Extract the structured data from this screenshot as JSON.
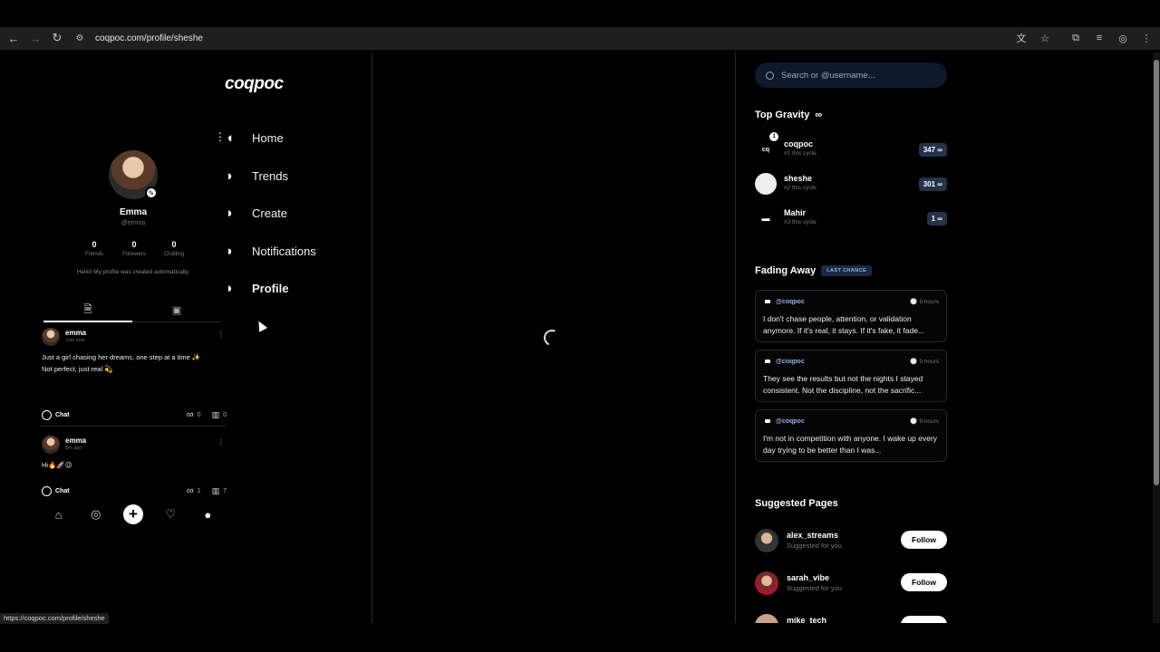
{
  "browser": {
    "url": "coqpoc.com/profile/sheshe",
    "status_url": "https://coqpoc.com/profile/sheshe"
  },
  "app": {
    "logo": "coqpoc"
  },
  "nav": {
    "items": [
      {
        "label": "Home",
        "icon": "home-icon"
      },
      {
        "label": "Trends",
        "icon": "trends-icon"
      },
      {
        "label": "Create",
        "icon": "create-icon"
      },
      {
        "label": "Notifications",
        "icon": "bell-icon"
      },
      {
        "label": "Profile",
        "icon": "profile-icon",
        "active": true
      }
    ]
  },
  "profile": {
    "name": "Emma",
    "handle": "@emma",
    "stats": [
      {
        "value": "0",
        "label": "Friends"
      },
      {
        "value": "0",
        "label": "Followers"
      },
      {
        "value": "0",
        "label": "Chatting"
      }
    ],
    "bio": "Hello! My profile was created automatically."
  },
  "posts": [
    {
      "author": "emma",
      "time": "Just now",
      "text": "Just a girl chasing her dreams, one step at a time ✨\nNot perfect, just real 💫",
      "chat_label": "Chat",
      "gravity": "0",
      "views": "0"
    },
    {
      "author": "emma",
      "time": "8m ago",
      "text": "Hi🔥🚀😉",
      "chat_label": "Chat",
      "gravity": "1",
      "views": "7"
    }
  ],
  "search": {
    "placeholder": "Search or @username..."
  },
  "top_gravity": {
    "title": "Top Gravity",
    "symbol": "∞",
    "rows": [
      {
        "name": "coqpoc",
        "sub": "#1 this cycle",
        "score": "347 ∞",
        "badge": "1"
      },
      {
        "name": "sheshe",
        "sub": "#2 this cycle",
        "score": "301 ∞"
      },
      {
        "name": "Mahir",
        "sub": "#3 this cycle",
        "score": "1 ∞"
      }
    ]
  },
  "fading_away": {
    "title": "Fading Away",
    "badge": "LAST CHANCE",
    "cards": [
      {
        "handle": "@coqpoc",
        "time": "9 hours",
        "text": "I don't chase people, attention, or validation anymore. If it's real, it stays. If it's fake, it fade..."
      },
      {
        "handle": "@coqpoc",
        "time": "9 hours",
        "text": "They see the results but not the nights I stayed consistent. Not the discipline, not the sacrific..."
      },
      {
        "handle": "@coqpoc",
        "time": "9 hours",
        "text": "I'm not in competition with anyone. I wake up every day trying to be better than I was..."
      }
    ]
  },
  "suggested": {
    "title": "Suggested Pages",
    "rows": [
      {
        "name": "alex_streams",
        "sub": "Suggested for you",
        "button": "Follow"
      },
      {
        "name": "sarah_vibe",
        "sub": "Suggested for you",
        "button": "Follow"
      },
      {
        "name": "mike_tech",
        "sub": "",
        "button": ""
      }
    ]
  },
  "colors": {
    "background": "#000000",
    "accent_badge": "#24324a",
    "link_blue": "#8fb2e6",
    "search_bg": "#0e1a2b"
  }
}
